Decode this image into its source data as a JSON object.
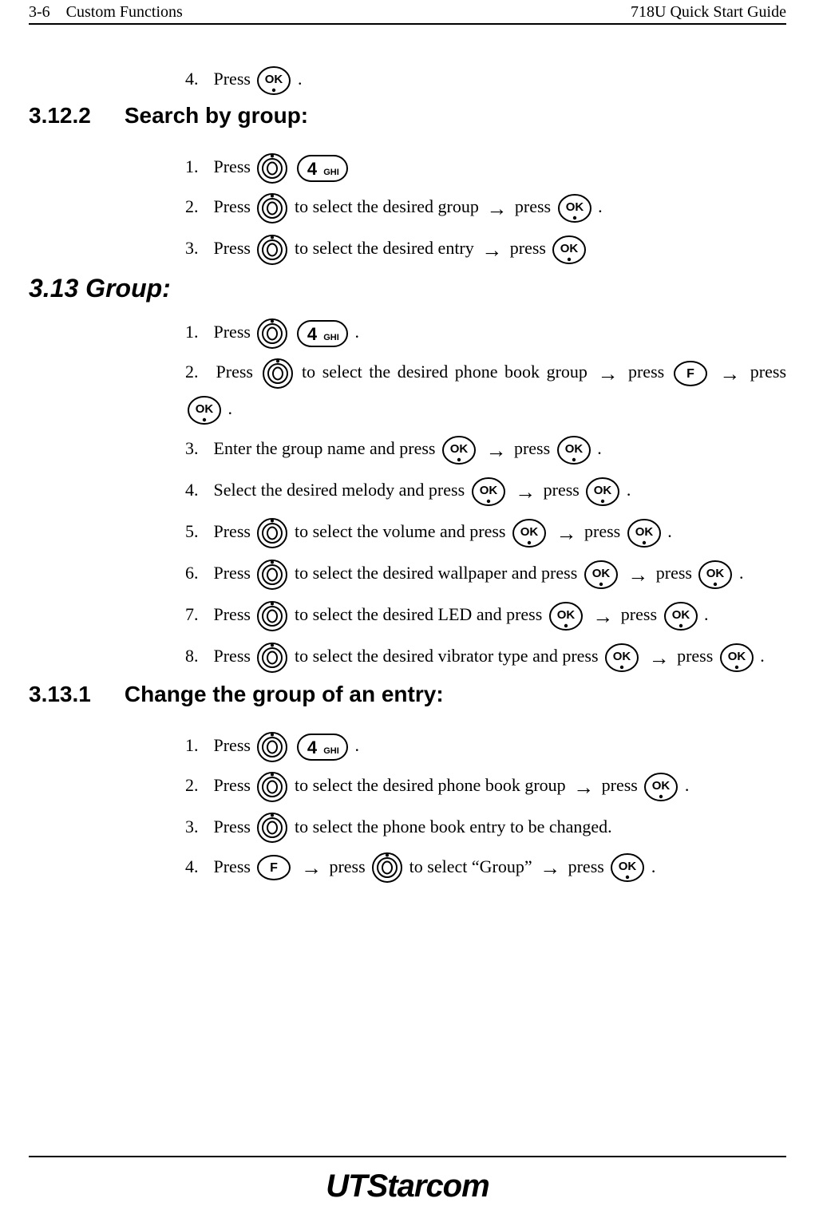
{
  "header": {
    "left": "3-6 Custom Functions",
    "right": "718U Quick Start Guide"
  },
  "glyphs": {
    "arrow": "→",
    "ok_label": "OK",
    "f_label": "F",
    "key_label": "4",
    "key_letters": "GHI"
  },
  "sec_a": {
    "step4_a": "Press ",
    "step4_b": "."
  },
  "h_3_12_2": {
    "num": "3.12.2",
    "title": "Search by group:"
  },
  "sec_b": {
    "s1_a": "Press ",
    "s2_a": "Press ",
    "s2_b": " to select the desired group ",
    "s2_c": " press ",
    "s2_d": ".",
    "s3_a": "Press ",
    "s3_b": " to select the desired entry ",
    "s3_c": " press "
  },
  "h_3_13": "3.13 Group:",
  "sec_c": {
    "s1_a": "Press ",
    "s1_b": ".",
    "s2_a": "Press ",
    "s2_b": " to select the desired phone book group ",
    "s2_c": " press ",
    "s2_d": " press ",
    "s2_e": ".",
    "s3_a": "Enter the group name and press ",
    "s3_b": " press ",
    "s3_c": ".",
    "s4_a": "Select the desired melody and press ",
    "s4_b": " press ",
    "s4_c": ".",
    "s5_a": "Press ",
    "s5_b": " to select the volume and press ",
    "s5_c": " press ",
    "s5_d": ".",
    "s6_a": "Press ",
    "s6_b": " to select the desired wallpaper and press ",
    "s6_c": " press ",
    "s6_d": ".",
    "s7_a": "Press ",
    "s7_b": " to select the desired LED and press ",
    "s7_c": " press ",
    "s7_d": ".",
    "s8_a": "Press ",
    "s8_b": " to select the desired vibrator type and press ",
    "s8_c": " press ",
    "s8_d": "."
  },
  "h_3_13_1": {
    "num": "3.13.1",
    "title": "Change the group of an entry:"
  },
  "sec_d": {
    "s1_a": "Press ",
    "s1_b": ".",
    "s2_a": "Press ",
    "s2_b": " to select the desired phone book group ",
    "s2_c": " press ",
    "s2_d": ".",
    "s3_a": "Press ",
    "s3_b": " to select the phone book entry to be changed.",
    "s4_a": "Press ",
    "s4_b": " press ",
    "s4_c": " to select “Group” ",
    "s4_d": " press ",
    "s4_e": "."
  },
  "logo": {
    "ut": "UT",
    "rest": "Starcom"
  }
}
